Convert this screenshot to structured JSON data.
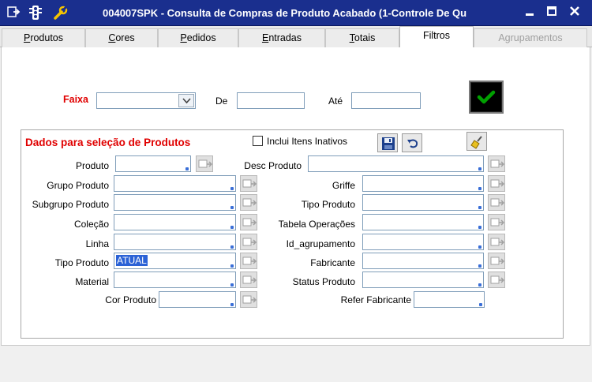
{
  "window": {
    "title": "004007SPK - Consulta de Compras de Produto Acabado (1-Controle De Qu",
    "icons": [
      "menu-icon",
      "traffic-light-icon",
      "wrench-icon"
    ],
    "controls": [
      "minimize",
      "maximize",
      "close"
    ]
  },
  "tabs": [
    {
      "label": "Produtos",
      "accent": "P"
    },
    {
      "label": "Cores",
      "accent": "C"
    },
    {
      "label": "Pedidos",
      "accent": "P"
    },
    {
      "label": "Entradas",
      "accent": "E"
    },
    {
      "label": "Totais",
      "accent": "T"
    },
    {
      "label": "Filtros",
      "active": true
    },
    {
      "label": "Agrupamentos",
      "disabled": true
    }
  ],
  "range": {
    "faixa_label": "Faixa",
    "faixa_value": "",
    "de_label": "De",
    "de_value": "",
    "ate_label": "Até",
    "ate_value": ""
  },
  "group": {
    "title": "Dados para seleção de Produtos",
    "include_inactive_label": "Inclui Itens Inativos",
    "include_inactive_checked": false
  },
  "left_fields": [
    {
      "label": "Produto",
      "value": ""
    },
    {
      "label": "Grupo Produto",
      "value": ""
    },
    {
      "label": "Subgrupo Produto",
      "value": ""
    },
    {
      "label": "Coleção",
      "value": ""
    },
    {
      "label": "Linha",
      "value": ""
    },
    {
      "label": "Tipo Produto",
      "value": "ATUAL"
    },
    {
      "label": "Material",
      "value": ""
    },
    {
      "label": "Cor Produto",
      "value": ""
    }
  ],
  "right_fields": [
    {
      "label": "Desc Produto",
      "value": ""
    },
    {
      "label": "Griffe",
      "value": ""
    },
    {
      "label": "Tipo Produto",
      "value": ""
    },
    {
      "label": "Tabela Operações",
      "value": ""
    },
    {
      "label": "Id_agrupamento",
      "value": ""
    },
    {
      "label": "Fabricante",
      "value": ""
    },
    {
      "label": "Status Produto",
      "value": ""
    },
    {
      "label": "Refer Fabricante",
      "value": ""
    }
  ],
  "colors": {
    "titlebar": "#1a2f8e",
    "required_label": "#e00000",
    "ok_check": "#00a000",
    "selection": "#2b62d6"
  }
}
